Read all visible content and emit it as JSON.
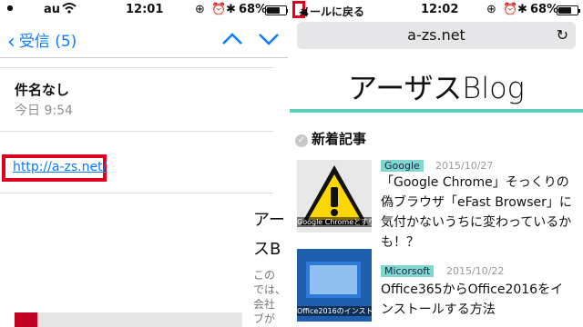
{
  "left": {
    "status": {
      "carrier": "au",
      "time": "12:01",
      "battery": "68%"
    },
    "nav": {
      "back_label": "受信 (5)"
    },
    "mail": {
      "subject": "件名なし",
      "date": "今日 9:54",
      "link": "http://a-zs.net/",
      "preview_title_1": "アー",
      "preview_title_2": "スB",
      "preview_lines": [
        "この",
        "では、",
        "会社",
        "ブが"
      ]
    }
  },
  "right": {
    "status": {
      "back_to_mail": "メールに戻る",
      "time": "12:02",
      "battery": "68%"
    },
    "address": "a-zs.net",
    "blog_title": "アーザスBlog",
    "section_label": "新着記事",
    "articles": [
      {
        "tag": "Google",
        "date": "2015/10/27",
        "title": "「Google Chrome」そっくりの偽ブラウザ「eFast Browser」に気付かないうちに変わっているかも！？",
        "thumb_caption": "Google Chromeとすり替わる偽のブラウザに注意"
      },
      {
        "tag": "Micorsoft",
        "date": "2015/10/22",
        "title": "Office365からOffice2016をインストールする方法",
        "thumb_caption": "Office2016のインストール"
      }
    ]
  },
  "colors": {
    "ios_blue": "#0a7aff",
    "highlight_red": "#e0001b",
    "teal": "#5ecfbf"
  }
}
